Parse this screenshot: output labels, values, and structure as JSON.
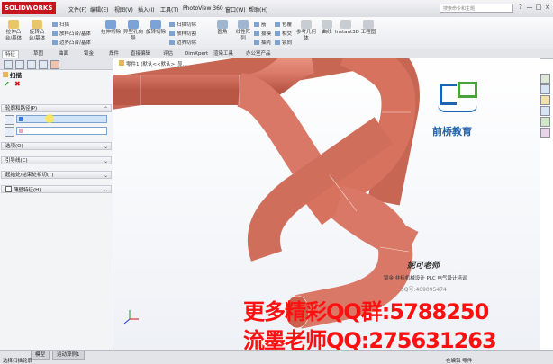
{
  "app": {
    "logo": "SOLIDWORKS"
  },
  "menu": [
    "文件(F)",
    "编辑(E)",
    "视图(V)",
    "插入(I)",
    "工具(T)",
    "PhotoView 360",
    "窗口(W)",
    "帮助(H)"
  ],
  "search": {
    "placeholder": "搜索命令和主题"
  },
  "window_controls": [
    "?",
    "—",
    "□",
    "×"
  ],
  "ribbon": {
    "big_buttons": [
      "拉伸凸台/基体",
      "旋转凸台/基体",
      "拉伸切除",
      "异型孔向导",
      "旋转切除",
      "圆角",
      "线性阵列",
      "筋",
      "拔模",
      "抽壳",
      "参考几何体",
      "曲线",
      "Instant3D",
      "工程图"
    ],
    "small_buttons": [
      "扫描",
      "放样凸台/基体",
      "边界凸台/基体",
      "扫描切除",
      "放样切割",
      "边界切除",
      "包覆",
      "相交",
      "镜向"
    ]
  },
  "tabs": [
    "特征",
    "草图",
    "曲面",
    "钣金",
    "焊件",
    "直接编辑",
    "评估",
    "DimXpert",
    "渲染工具",
    "办公室产品"
  ],
  "active_tab": "特征",
  "property_manager": {
    "title": "扫描",
    "ok": "✔",
    "cancel": "✖",
    "sections": [
      {
        "label": "轮廓和路径(P)",
        "expanded": true
      },
      {
        "label": "选项(O)",
        "expanded": false
      },
      {
        "label": "引导线(C)",
        "expanded": false
      },
      {
        "label": "起始处/结束处相切(T)",
        "expanded": false
      },
      {
        "label": "薄壁特征(H)",
        "expanded": false
      }
    ]
  },
  "breadcrumb": "零件1 (默认<<默认>_显...",
  "watermark": {
    "brand": "前桥教育",
    "teacher": "妮可老师",
    "subtitle": "钣金 非标机械设计 PLC 电气设计培训",
    "qq_small": "QQ号:469095474"
  },
  "overlay": {
    "line1": "更多精彩QQ群:5788250",
    "line2": "流墨老师QQ:275631263"
  },
  "bottom_tabs": [
    "模型",
    "运动算例1"
  ],
  "status": {
    "left": "选择扫描轮廓",
    "right": "在编辑 零件"
  },
  "colors": {
    "pipe": "#d97866",
    "pipe_dark": "#b85746",
    "overlay_red": "#ff1010",
    "brand_blue": "#1d63b1",
    "brand_green": "#4aa33a"
  }
}
